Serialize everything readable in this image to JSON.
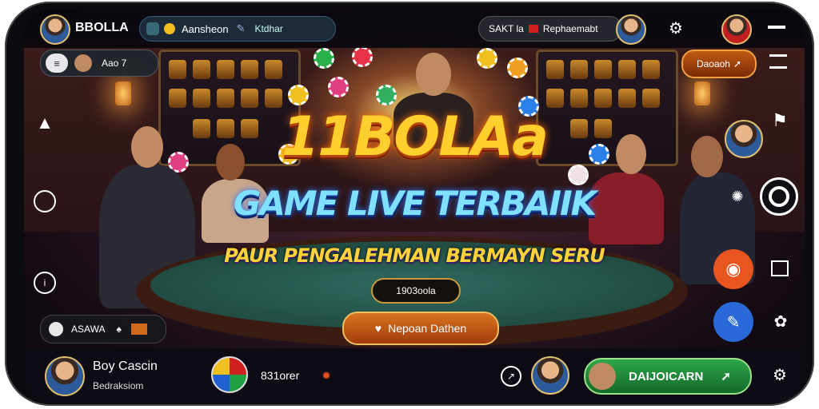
{
  "header": {
    "brand": "BBOLLA",
    "search_value": "Aansheon",
    "search_tag": "Ktdhar",
    "account_label": "SAKT la",
    "account_name": "Rephaemabt"
  },
  "left_panel": {
    "menu_badge": "Aao 7"
  },
  "right_panel": {
    "action_button": "Daoaoh"
  },
  "hero": {
    "title": "11BOLAa",
    "subtitle": "GAME LIVE TERBAIIK",
    "tagline": "PAUR PENGALEHMAN BERMAYN SERU",
    "counter": "1903oola",
    "primary_button": "Nepoan Dathen"
  },
  "left_bottom": {
    "label": "ASAWA"
  },
  "bottom_bar": {
    "user_name": "Boy Cascin",
    "user_sub": "Bedraksiom",
    "game_count": "831orer",
    "cta_button": "DAIJOICARN"
  },
  "colors": {
    "gold": "#ffcf2e",
    "cyan": "#7fe0ff",
    "cta_green": "#1f8a3a",
    "orange": "#e8551f",
    "blue": "#2a6ad8"
  }
}
